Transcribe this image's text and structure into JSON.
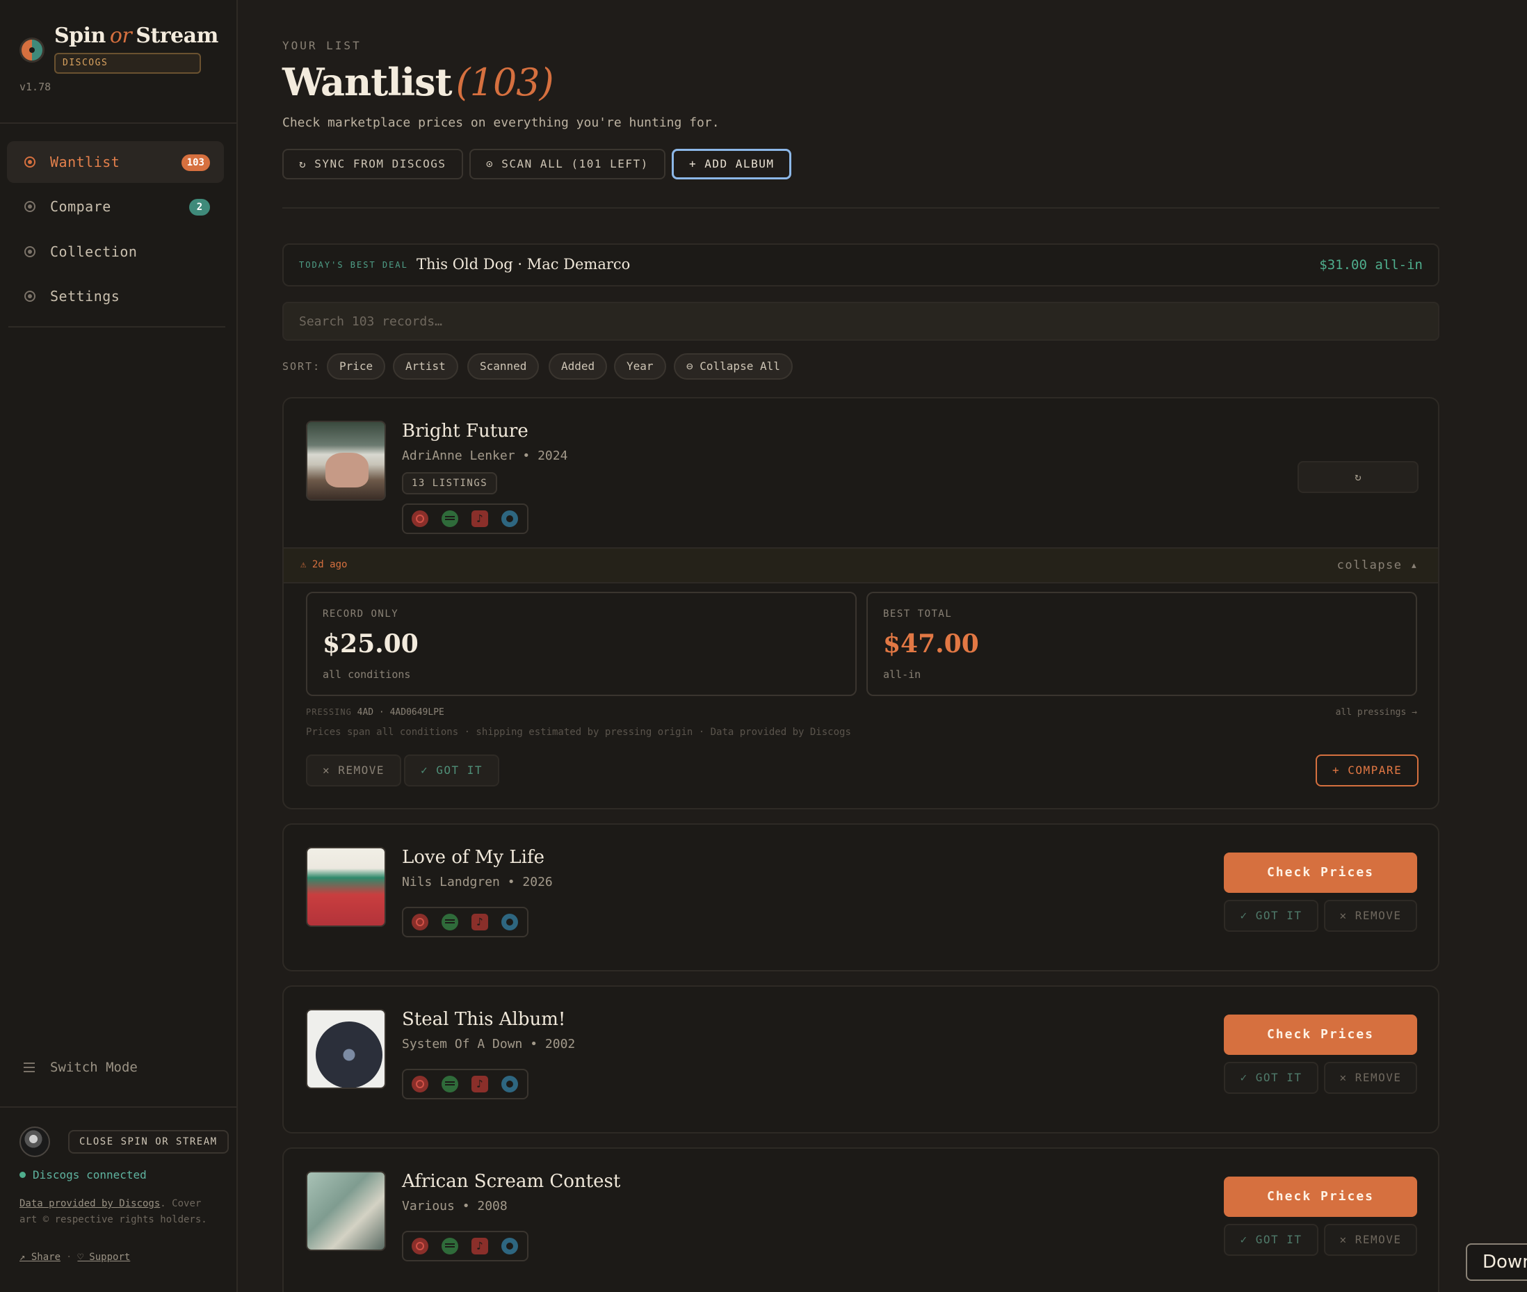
{
  "app": {
    "name_part1": "Spin",
    "name_or": "or",
    "name_part2": "Stream",
    "badge": "DISCOGS",
    "version": "v1.78"
  },
  "nav": [
    {
      "label": "Wantlist",
      "badge": "103",
      "active": true
    },
    {
      "label": "Compare",
      "badge": "2"
    },
    {
      "label": "Collection"
    },
    {
      "label": "Settings"
    }
  ],
  "sidebar_footer": {
    "switch_mode": "Switch Mode",
    "close_label": "CLOSE SPIN OR STREAM",
    "status": "Discogs connected",
    "credit_link": "Data provided by Discogs",
    "credit_rest": ". Cover art © respective rights holders.",
    "share": "↗ Share",
    "support": "♡ Support"
  },
  "header": {
    "eyebrow": "YOUR LIST",
    "title": "Wantlist",
    "count": "(103)",
    "subtitle": "Check marketplace prices on everything you're hunting for.",
    "buttons": [
      "↻ SYNC FROM DISCOGS",
      "⊙ SCAN ALL (101 LEFT)",
      "+ ADD ALBUM"
    ]
  },
  "deal": {
    "tag": "TODAY'S BEST DEAL",
    "title": "This Old Dog · Mac Demarco",
    "price": "$31.00 all-in"
  },
  "search": {
    "placeholder": "Search 103 records…"
  },
  "sort": {
    "label": "SORT:",
    "options": [
      "Price",
      "Artist",
      "Scanned",
      "Added",
      "Year",
      "⊖ Collapse All"
    ]
  },
  "albums": [
    {
      "title": "Bright Future",
      "meta": "AdriAnne Lenker • 2024",
      "listings": "13 LISTINGS",
      "refresh": "↻",
      "scanned": "⚠ 2d ago",
      "collapse": "collapse ▴",
      "record_only_label": "RECORD ONLY",
      "record_only_value": "$25.00",
      "record_only_sub": "all conditions",
      "best_total_label": "BEST TOTAL",
      "best_total_value": "$47.00",
      "best_total_sub": "all-in",
      "pressing_key": "PRESSING",
      "pressing_value": "4AD · 4AD0649LPE",
      "all_pressings": "all pressings →",
      "disclaimer": "Prices span all conditions · shipping estimated by pressing origin · Data provided by Discogs",
      "remove": "✕ REMOVE",
      "got_it": "✓ GOT IT",
      "compare": "+ COMPARE"
    },
    {
      "title": "Love of My Life",
      "meta": "Nils Landgren • 2026",
      "check": "Check Prices",
      "got_it": "✓ GOT IT",
      "remove": "✕ REMOVE"
    },
    {
      "title": "Steal This Album!",
      "meta": "System Of A Down • 2002",
      "check": "Check Prices",
      "got_it": "✓ GOT IT",
      "remove": "✕ REMOVE"
    },
    {
      "title": "African Scream Contest",
      "meta": "Various • 2008",
      "check": "Check Prices",
      "got_it": "✓ GOT IT",
      "remove": "✕ REMOVE"
    }
  ],
  "icons": [
    "youtube-icon",
    "spotify-icon",
    "apple-music-icon",
    "discogs-icon"
  ],
  "colors": {
    "accent": "#d6703f",
    "teal": "#3f8a7a",
    "deal_green": "#4fae8d",
    "background": "#1f1c19"
  },
  "floating": {
    "download": "Down"
  }
}
